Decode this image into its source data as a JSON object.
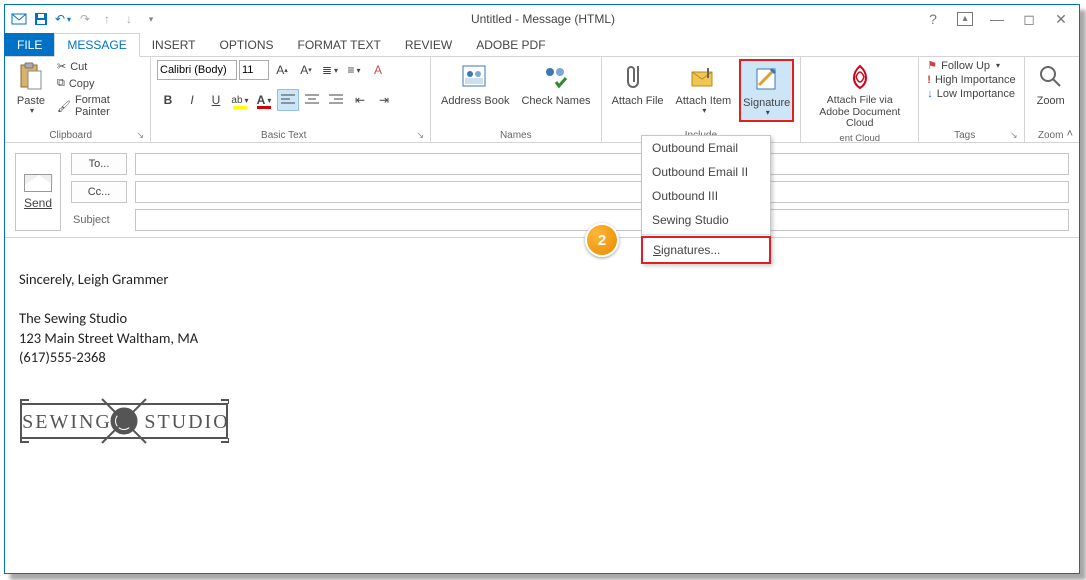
{
  "title": "Untitled - Message (HTML)",
  "qat": {
    "save": "💾"
  },
  "tabs": {
    "file": "FILE",
    "message": "MESSAGE",
    "insert": "INSERT",
    "options": "OPTIONS",
    "format_text": "FORMAT TEXT",
    "review": "REVIEW",
    "adobe_pdf": "ADOBE PDF"
  },
  "ribbon": {
    "clipboard": {
      "label": "Clipboard",
      "paste": "Paste",
      "cut": "Cut",
      "copy": "Copy",
      "format_painter": "Format Painter"
    },
    "basic_text": {
      "label": "Basic Text",
      "font_name": "Calibri (Body)",
      "font_size": "11"
    },
    "names": {
      "label": "Names",
      "address_book": "Address Book",
      "check_names": "Check Names"
    },
    "include": {
      "label": "Include",
      "attach_file": "Attach File",
      "attach_item": "Attach Item",
      "signature": "Signature"
    },
    "adobe": {
      "label": "Adobe Document Cloud",
      "attach_via": "Attach File via Adobe Document Cloud"
    },
    "tags": {
      "label": "Tags",
      "follow_up": "Follow Up",
      "high": "High Importance",
      "low": "Low Importance"
    },
    "zoom": {
      "label": "Zoom",
      "zoom": "Zoom"
    }
  },
  "header": {
    "send": "Send",
    "to": "To...",
    "cc": "Cc...",
    "subject": "Subject",
    "to_value": "",
    "cc_value": "",
    "subject_value": ""
  },
  "signature_menu": {
    "items": [
      "Outbound Email",
      "Outbound Email II",
      "Outbound III",
      "Sewing Studio"
    ],
    "signatures": "Signatures..."
  },
  "body": {
    "line1": "Sincerely,   Leigh Grammer",
    "line2": "The Sewing Studio",
    "line3": "123 Main Street Waltham, MA",
    "line4": "(617)555-2368",
    "logo_left": "SEWING",
    "logo_right": "STUDIO"
  },
  "callout": "2"
}
